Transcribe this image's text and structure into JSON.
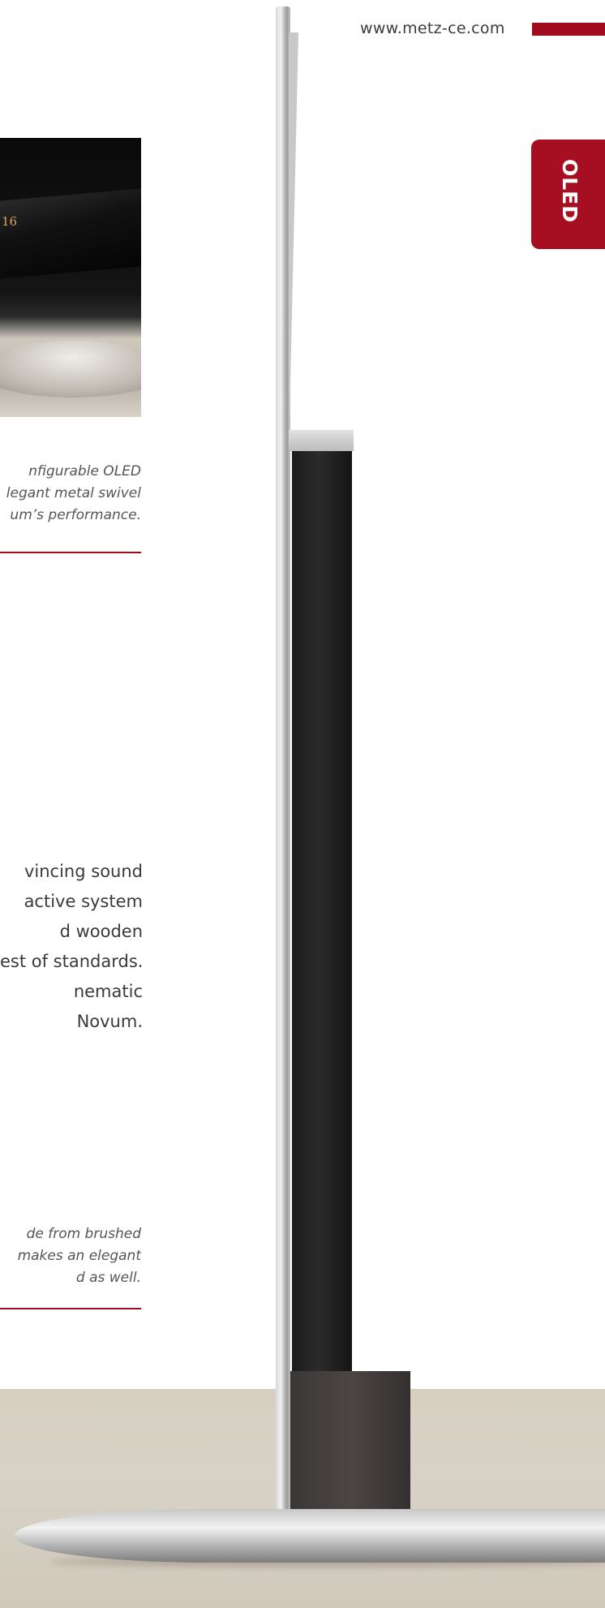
{
  "header": {
    "url": "www.metz-ce.com",
    "accent_color": "#a00c1e"
  },
  "side_tab": {
    "label": "OLED",
    "color": "#a50f21"
  },
  "photo": {
    "readout": "16"
  },
  "captions": [
    {
      "lines": [
        "nfigurable OLED",
        "legant metal swivel",
        "um’s performance."
      ]
    },
    {
      "lines": [
        "de from brushed",
        "makes an elegant",
        "d as well."
      ]
    }
  ],
  "body": {
    "lines": [
      "vincing sound",
      "active system",
      "d wooden",
      "est of standards.",
      "nematic",
      "Novum."
    ]
  }
}
